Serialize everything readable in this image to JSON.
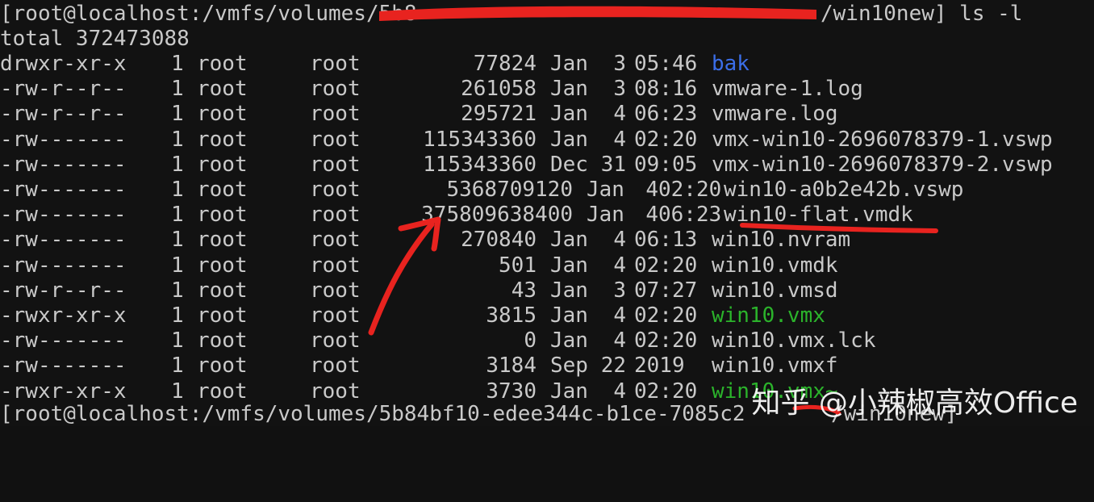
{
  "prompt_top": "[root@localhost:/vmfs/volumes/5b8",
  "prompt_top_tail": "/win10new] ls -l",
  "total_line": "total 372473088",
  "entries": [
    {
      "perm": "drwxr-xr-x",
      "links": "1",
      "owner": "root",
      "group": "root",
      "size": "77824",
      "month": "Jan",
      "day": "3",
      "time": "05:46",
      "name": "bak",
      "kind": "dir"
    },
    {
      "perm": "-rw-r--r--",
      "links": "1",
      "owner": "root",
      "group": "root",
      "size": "261058",
      "month": "Jan",
      "day": "3",
      "time": "08:16",
      "name": "vmware-1.log",
      "kind": "file"
    },
    {
      "perm": "-rw-r--r--",
      "links": "1",
      "owner": "root",
      "group": "root",
      "size": "295721",
      "month": "Jan",
      "day": "4",
      "time": "06:23",
      "name": "vmware.log",
      "kind": "file"
    },
    {
      "perm": "-rw-------",
      "links": "1",
      "owner": "root",
      "group": "root",
      "size": "115343360",
      "month": "Jan",
      "day": "4",
      "time": "02:20",
      "name": "vmx-win10-2696078379-1.vswp",
      "kind": "file"
    },
    {
      "perm": "-rw-------",
      "links": "1",
      "owner": "root",
      "group": "root",
      "size": "115343360",
      "month": "Dec",
      "day": "31",
      "time": "09:05",
      "name": "vmx-win10-2696078379-2.vswp",
      "kind": "file"
    },
    {
      "perm": "-rw-------",
      "links": "1",
      "owner": "root",
      "group": "root",
      "size": "5368709120",
      "month": "Jan",
      "day": "4",
      "time": "02:20",
      "name": "win10-a0b2e42b.vswp",
      "kind": "file"
    },
    {
      "perm": "-rw-------",
      "links": "1",
      "owner": "root",
      "group": "root",
      "size": "375809638400",
      "month": "Jan",
      "day": "4",
      "time": "06:23",
      "name": "win10-flat.vmdk",
      "kind": "file"
    },
    {
      "perm": "-rw-------",
      "links": "1",
      "owner": "root",
      "group": "root",
      "size": "270840",
      "month": "Jan",
      "day": "4",
      "time": "06:13",
      "name": "win10.nvram",
      "kind": "file"
    },
    {
      "perm": "-rw-------",
      "links": "1",
      "owner": "root",
      "group": "root",
      "size": "501",
      "month": "Jan",
      "day": "4",
      "time": "02:20",
      "name": "win10.vmdk",
      "kind": "file"
    },
    {
      "perm": "-rw-r--r--",
      "links": "1",
      "owner": "root",
      "group": "root",
      "size": "43",
      "month": "Jan",
      "day": "3",
      "time": "07:27",
      "name": "win10.vmsd",
      "kind": "file"
    },
    {
      "perm": "-rwxr-xr-x",
      "links": "1",
      "owner": "root",
      "group": "root",
      "size": "3815",
      "month": "Jan",
      "day": "4",
      "time": "02:20",
      "name": "win10.vmx",
      "kind": "exec"
    },
    {
      "perm": "-rw-------",
      "links": "1",
      "owner": "root",
      "group": "root",
      "size": "0",
      "month": "Jan",
      "day": "4",
      "time": "02:20",
      "name": "win10.vmx.lck",
      "kind": "file"
    },
    {
      "perm": "-rw-------",
      "links": "1",
      "owner": "root",
      "group": "root",
      "size": "3184",
      "month": "Sep",
      "day": "22",
      "time": "2019",
      "name": "win10.vmxf",
      "kind": "file"
    },
    {
      "perm": "-rwxr-xr-x",
      "links": "1",
      "owner": "root",
      "group": "root",
      "size": "3730",
      "month": "Jan",
      "day": "4",
      "time": "02:20",
      "name": "win10.vmx~",
      "kind": "exec"
    }
  ],
  "prompt_bottom": "[root@localhost:/vmfs/volumes/5b84bf10-edee344c-b1ce-7085c2",
  "prompt_bottom_tail": "/win10new]",
  "watermark": "知乎 @小辣椒高效Office",
  "colors": {
    "background": "#121212",
    "text": "#c9c9c9",
    "directory": "#3b6ee8",
    "executable": "#2bb32b",
    "annotation": "#e8231f"
  }
}
